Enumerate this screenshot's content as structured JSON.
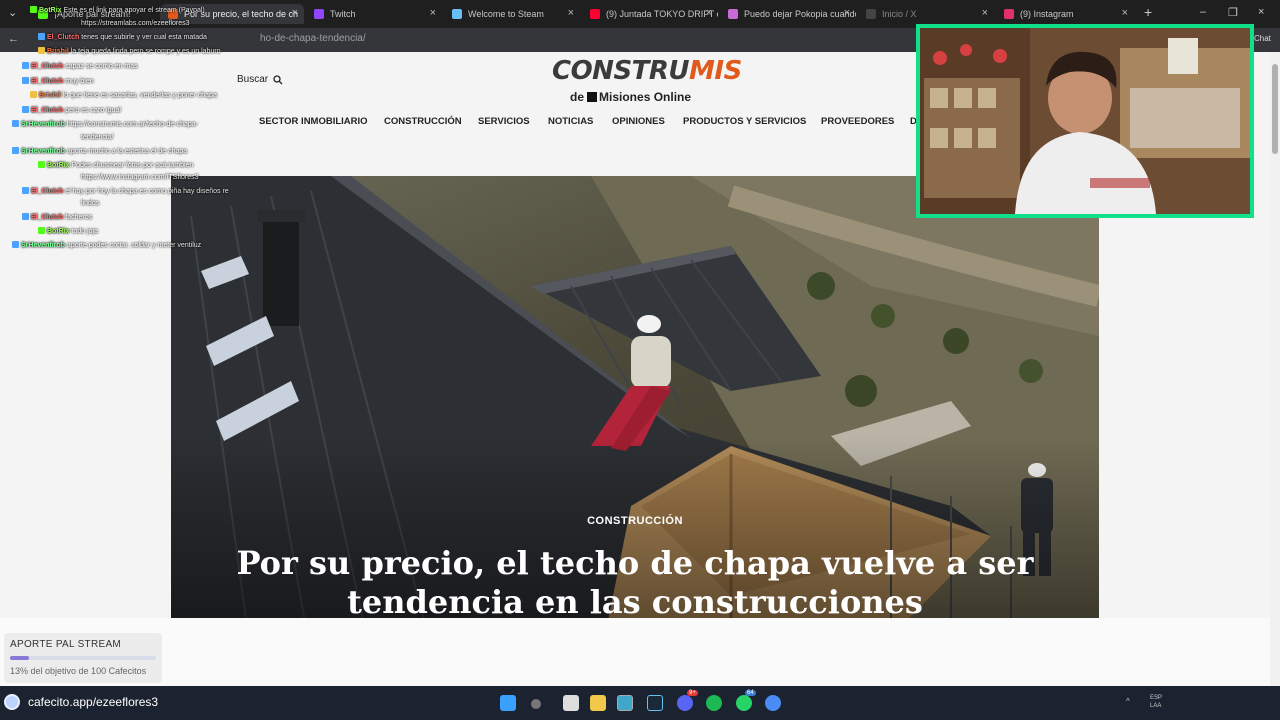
{
  "browser": {
    "tabs": [
      {
        "label": "¡Aporte pal stream!",
        "active": false
      },
      {
        "label": "Por su precio, el techo de ch",
        "active": true
      },
      {
        "label": "Twitch",
        "active": false
      },
      {
        "label": "Welcome to Steam",
        "active": false
      },
      {
        "label": "(9) Juntada TOKYO DRIFT en",
        "active": false
      },
      {
        "label": "Puedo dejar Pokopia cuando",
        "active": false
      },
      {
        "label": "Inicio / X",
        "active": false
      },
      {
        "label": "(9) Instagram",
        "active": false
      }
    ],
    "url_path": "ho-de-chapa-tendencia/",
    "chat_button": "Chat"
  },
  "site": {
    "logo_main": "CONSTRU",
    "logo_accent": "MIS",
    "logo_sub_prefix": "de",
    "logo_sub_brand": "Misiones Online",
    "search_label": "Buscar",
    "nav": [
      "SECTOR INMOBILIARIO",
      "CONSTRUCCIÓN",
      "SERVICIOS",
      "NOTICIAS",
      "OPINIONES",
      "PRODUCTOS Y SERVICIOS",
      "PROVEEDORES",
      "D"
    ]
  },
  "article": {
    "category": "CONSTRUCCIÓN",
    "title": "Por su precio, el techo de chapa vuelve a ser tendencia en las construcciones"
  },
  "chat": [
    {
      "user": "BotRix",
      "msg": "Este es el link para apoyar el stream (Paypal)",
      "color": "#9dff5c"
    },
    {
      "user": "",
      "msg": "https://streamlabs.com/ezeeflores3",
      "color": "#ffffff"
    },
    {
      "user": "El_Clutch",
      "msg": "tenes que subirle y ver cual esta matada",
      "color": "#ff6b6b"
    },
    {
      "user": "Brishil",
      "msg": "la teja queda linda pero se rompe y es un laburo",
      "color": "#ff7a3d"
    },
    {
      "user": "El_Clutch",
      "msg": "capaz se corrio en mas",
      "color": "#ff6b6b"
    },
    {
      "user": "El_Clutch",
      "msg": "muy bien",
      "color": "#ff6b6b"
    },
    {
      "user": "Brishil",
      "msg": "lo que tiene es sacarlas, venderlas y poner chapa",
      "color": "#ff7a3d"
    },
    {
      "user": "El_Clutch",
      "msg": "pero es caro igual",
      "color": "#ff6b6b"
    },
    {
      "user": "SrHevenfirob",
      "msg": "https://construmis.com.ar/techo-de-chapa-",
      "color": "#7cff9b"
    },
    {
      "user": "",
      "msg": "tendencia/",
      "color": "#ffffff"
    },
    {
      "user": "SrHevenfirob",
      "msg": "aporta mucho a la estetica el de chapa",
      "color": "#7cff9b"
    },
    {
      "user": "BotRix",
      "msg": "Podes chusmear fotos por acá tambien",
      "color": "#9dff5c"
    },
    {
      "user": "",
      "msg": "https://www.instagram.com/ITSflores3",
      "color": "#ffffff"
    },
    {
      "user": "El_Clutch",
      "msg": "el hoy por hoy la chapa es como piña hay diseños re",
      "color": "#ff6b6b"
    },
    {
      "user": "",
      "msg": "lindos",
      "color": "#ffffff"
    },
    {
      "user": "El_Clutch",
      "msg": "facheros",
      "color": "#ff6b6b"
    },
    {
      "user": "BotRix",
      "msg": "todo joja",
      "color": "#9dff5c"
    },
    {
      "user": "SrHevenfirob",
      "msg": "aporte podes cortar, soldar y meter ventiluz",
      "color": "#7cff9b"
    }
  ],
  "donation": {
    "title": "APORTE PAL STREAM",
    "progress_percent": 13,
    "progress_text": "13% del objetivo de 100 Cafecitos"
  },
  "cafecito_label": "cafecito.app/ezeeflores3",
  "taskbar": {
    "tray_lang": "ESP",
    "tray_region": "LAA",
    "badge_discord": "9+",
    "badge_whatsapp": "64"
  },
  "colors": {
    "webcam_border": "#11e08a",
    "logo_accent": "#e05a1c",
    "donation_fill": "#8a78d6"
  }
}
